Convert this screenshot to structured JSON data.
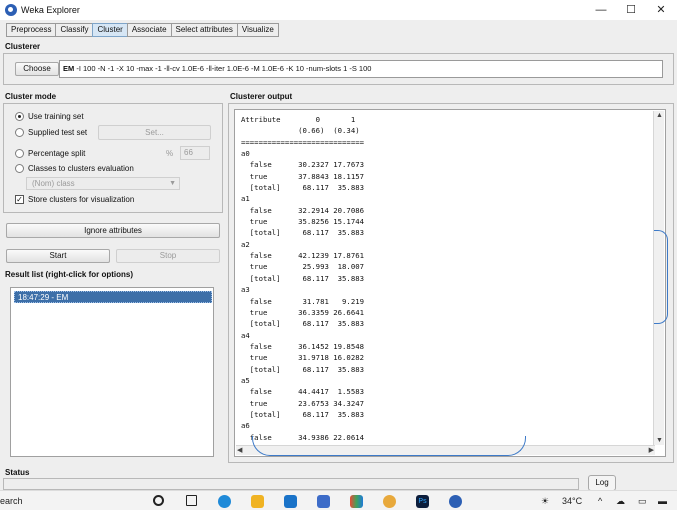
{
  "window": {
    "title": "Weka Explorer",
    "controls": {
      "minimize": "—",
      "maximize": "☐",
      "close": "✕"
    }
  },
  "tabs": [
    "Preprocess",
    "Classify",
    "Cluster",
    "Associate",
    "Select attributes",
    "Visualize"
  ],
  "active_tab": "Cluster",
  "clusterer": {
    "section_label": "Clusterer",
    "choose_label": "Choose",
    "algorithm": "EM",
    "options": "-I 100 -N -1 -X 10 -max -1 -ll-cv 1.0E-6 -ll-iter 1.0E-6 -M 1.0E-6 -K 10 -num-slots 1 -S 100"
  },
  "cluster_mode": {
    "section_label": "Cluster mode",
    "use_training_set": "Use training set",
    "supplied_test_set": "Supplied test set",
    "set_button": "Set...",
    "percentage_split": "Percentage split",
    "percent_sign": "%",
    "percent_value": "66",
    "classes_to_clusters": "Classes to clusters evaluation",
    "class_select": "(Nom) class",
    "store_clusters": "Store clusters for visualization",
    "selected": "Use training set",
    "store_clusters_checked": true
  },
  "ignore_attributes_label": "Ignore attributes",
  "start_label": "Start",
  "stop_label": "Stop",
  "result_list": {
    "label": "Result list (right-click for options)",
    "items": [
      "18:47:29 - EM"
    ]
  },
  "clusterer_output": {
    "label": "Clusterer output",
    "lines": [
      "Attribute        0       1",
      "             (0.66)  (0.34)",
      "============================",
      "a0",
      "  false      30.2327 17.7673",
      "  true       37.8843 18.1157",
      "  [total]     68.117  35.883",
      "a1",
      "  false      32.2914 20.7086",
      "  true       35.8256 15.1744",
      "  [total]     68.117  35.883",
      "a2",
      "  false      42.1239 17.8761",
      "  true        25.993  18.007",
      "  [total]     68.117  35.883",
      "a3",
      "  false       31.781   9.219",
      "  true       36.3359 26.6641",
      "  [total]     68.117  35.883",
      "a4",
      "  false      36.1452 19.8548",
      "  true       31.9718 16.0282",
      "  [total]     68.117  35.883",
      "a5",
      "  false      44.4417  1.5583",
      "  true       23.6753 34.3247",
      "  [total]     68.117  35.883",
      "a6",
      "  false      34.9386 22.0614"
    ]
  },
  "status_label": "Status",
  "log_label": "Log",
  "taskbar": {
    "search": "earch",
    "temperature": "34°C",
    "tray_up": "^"
  }
}
